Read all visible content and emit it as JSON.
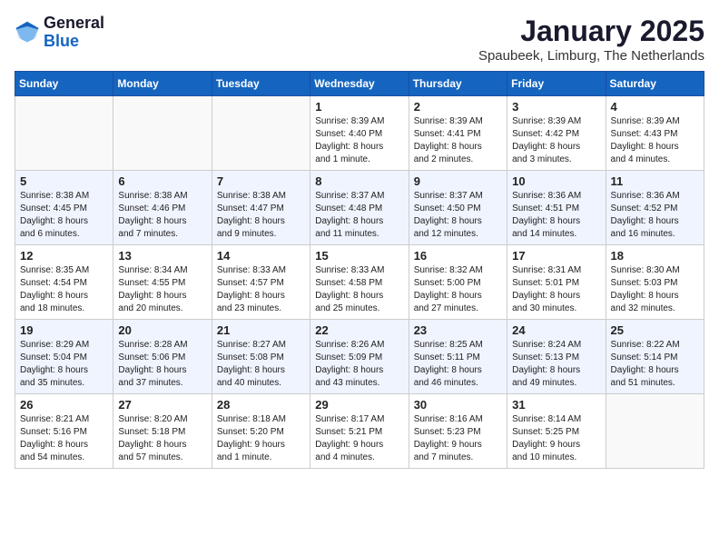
{
  "header": {
    "logo_general": "General",
    "logo_blue": "Blue",
    "month_year": "January 2025",
    "location": "Spaubeek, Limburg, The Netherlands"
  },
  "weekdays": [
    "Sunday",
    "Monday",
    "Tuesday",
    "Wednesday",
    "Thursday",
    "Friday",
    "Saturday"
  ],
  "weeks": [
    [
      {
        "day": "",
        "info": ""
      },
      {
        "day": "",
        "info": ""
      },
      {
        "day": "",
        "info": ""
      },
      {
        "day": "1",
        "info": "Sunrise: 8:39 AM\nSunset: 4:40 PM\nDaylight: 8 hours\nand 1 minute."
      },
      {
        "day": "2",
        "info": "Sunrise: 8:39 AM\nSunset: 4:41 PM\nDaylight: 8 hours\nand 2 minutes."
      },
      {
        "day": "3",
        "info": "Sunrise: 8:39 AM\nSunset: 4:42 PM\nDaylight: 8 hours\nand 3 minutes."
      },
      {
        "day": "4",
        "info": "Sunrise: 8:39 AM\nSunset: 4:43 PM\nDaylight: 8 hours\nand 4 minutes."
      }
    ],
    [
      {
        "day": "5",
        "info": "Sunrise: 8:38 AM\nSunset: 4:45 PM\nDaylight: 8 hours\nand 6 minutes."
      },
      {
        "day": "6",
        "info": "Sunrise: 8:38 AM\nSunset: 4:46 PM\nDaylight: 8 hours\nand 7 minutes."
      },
      {
        "day": "7",
        "info": "Sunrise: 8:38 AM\nSunset: 4:47 PM\nDaylight: 8 hours\nand 9 minutes."
      },
      {
        "day": "8",
        "info": "Sunrise: 8:37 AM\nSunset: 4:48 PM\nDaylight: 8 hours\nand 11 minutes."
      },
      {
        "day": "9",
        "info": "Sunrise: 8:37 AM\nSunset: 4:50 PM\nDaylight: 8 hours\nand 12 minutes."
      },
      {
        "day": "10",
        "info": "Sunrise: 8:36 AM\nSunset: 4:51 PM\nDaylight: 8 hours\nand 14 minutes."
      },
      {
        "day": "11",
        "info": "Sunrise: 8:36 AM\nSunset: 4:52 PM\nDaylight: 8 hours\nand 16 minutes."
      }
    ],
    [
      {
        "day": "12",
        "info": "Sunrise: 8:35 AM\nSunset: 4:54 PM\nDaylight: 8 hours\nand 18 minutes."
      },
      {
        "day": "13",
        "info": "Sunrise: 8:34 AM\nSunset: 4:55 PM\nDaylight: 8 hours\nand 20 minutes."
      },
      {
        "day": "14",
        "info": "Sunrise: 8:33 AM\nSunset: 4:57 PM\nDaylight: 8 hours\nand 23 minutes."
      },
      {
        "day": "15",
        "info": "Sunrise: 8:33 AM\nSunset: 4:58 PM\nDaylight: 8 hours\nand 25 minutes."
      },
      {
        "day": "16",
        "info": "Sunrise: 8:32 AM\nSunset: 5:00 PM\nDaylight: 8 hours\nand 27 minutes."
      },
      {
        "day": "17",
        "info": "Sunrise: 8:31 AM\nSunset: 5:01 PM\nDaylight: 8 hours\nand 30 minutes."
      },
      {
        "day": "18",
        "info": "Sunrise: 8:30 AM\nSunset: 5:03 PM\nDaylight: 8 hours\nand 32 minutes."
      }
    ],
    [
      {
        "day": "19",
        "info": "Sunrise: 8:29 AM\nSunset: 5:04 PM\nDaylight: 8 hours\nand 35 minutes."
      },
      {
        "day": "20",
        "info": "Sunrise: 8:28 AM\nSunset: 5:06 PM\nDaylight: 8 hours\nand 37 minutes."
      },
      {
        "day": "21",
        "info": "Sunrise: 8:27 AM\nSunset: 5:08 PM\nDaylight: 8 hours\nand 40 minutes."
      },
      {
        "day": "22",
        "info": "Sunrise: 8:26 AM\nSunset: 5:09 PM\nDaylight: 8 hours\nand 43 minutes."
      },
      {
        "day": "23",
        "info": "Sunrise: 8:25 AM\nSunset: 5:11 PM\nDaylight: 8 hours\nand 46 minutes."
      },
      {
        "day": "24",
        "info": "Sunrise: 8:24 AM\nSunset: 5:13 PM\nDaylight: 8 hours\nand 49 minutes."
      },
      {
        "day": "25",
        "info": "Sunrise: 8:22 AM\nSunset: 5:14 PM\nDaylight: 8 hours\nand 51 minutes."
      }
    ],
    [
      {
        "day": "26",
        "info": "Sunrise: 8:21 AM\nSunset: 5:16 PM\nDaylight: 8 hours\nand 54 minutes."
      },
      {
        "day": "27",
        "info": "Sunrise: 8:20 AM\nSunset: 5:18 PM\nDaylight: 8 hours\nand 57 minutes."
      },
      {
        "day": "28",
        "info": "Sunrise: 8:18 AM\nSunset: 5:20 PM\nDaylight: 9 hours\nand 1 minute."
      },
      {
        "day": "29",
        "info": "Sunrise: 8:17 AM\nSunset: 5:21 PM\nDaylight: 9 hours\nand 4 minutes."
      },
      {
        "day": "30",
        "info": "Sunrise: 8:16 AM\nSunset: 5:23 PM\nDaylight: 9 hours\nand 7 minutes."
      },
      {
        "day": "31",
        "info": "Sunrise: 8:14 AM\nSunset: 5:25 PM\nDaylight: 9 hours\nand 10 minutes."
      },
      {
        "day": "",
        "info": ""
      }
    ]
  ]
}
